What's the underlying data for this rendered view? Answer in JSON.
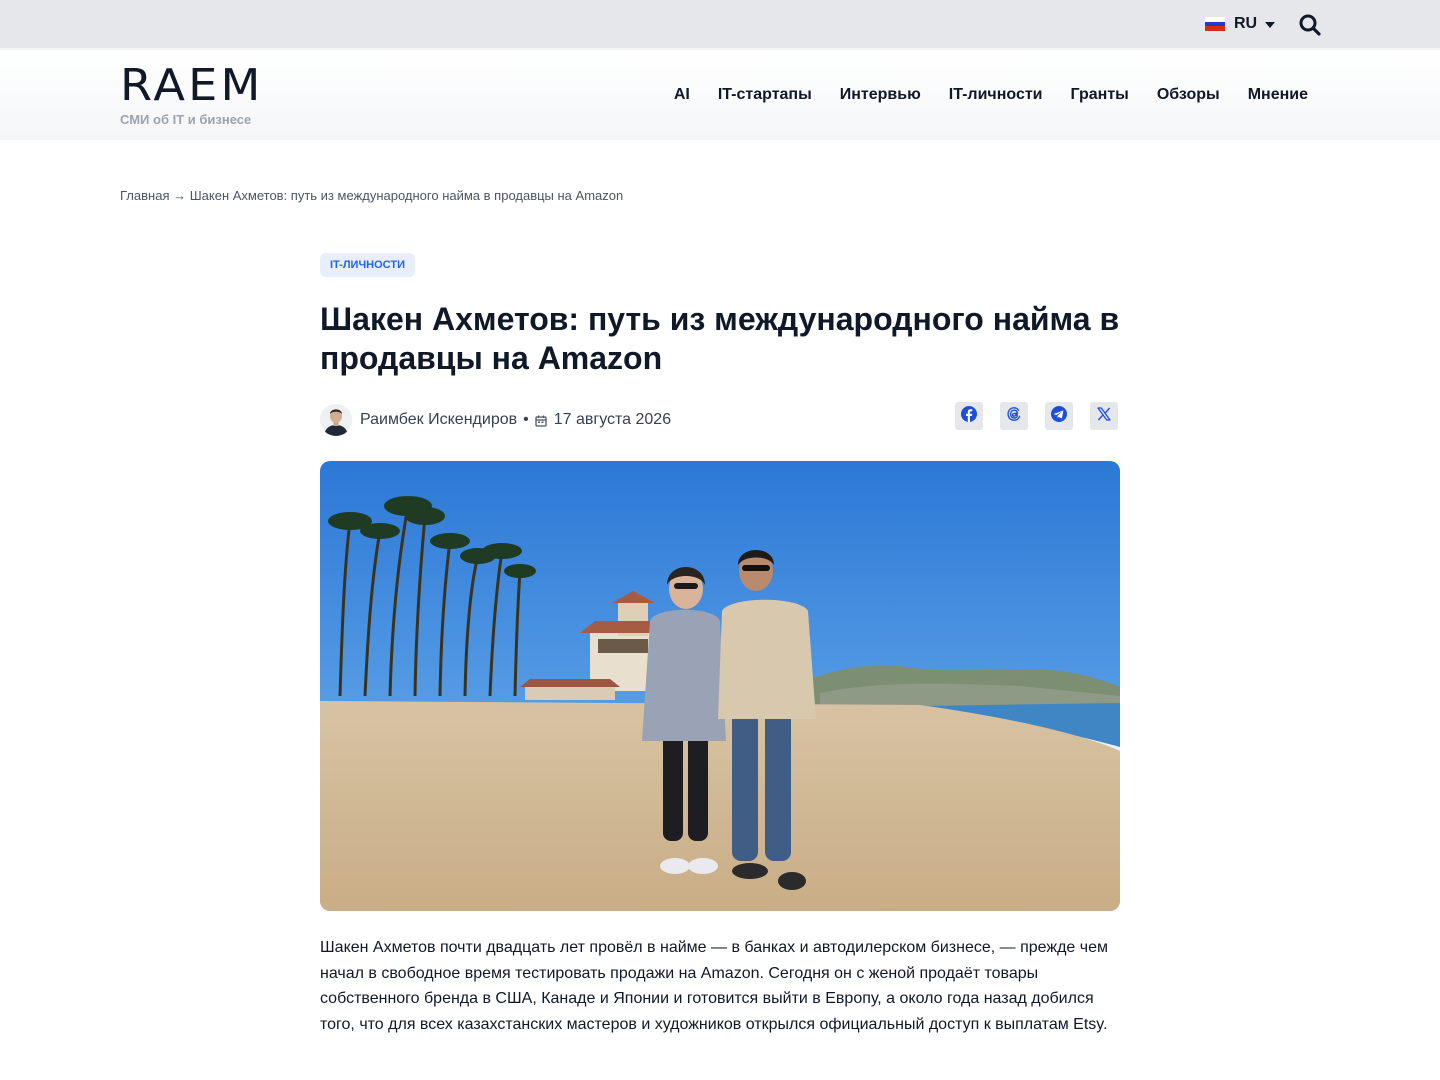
{
  "topbar": {
    "language": "RU",
    "flag_colors": [
      "#ffffff",
      "#1f3fbf",
      "#d52b1e"
    ]
  },
  "header": {
    "logo": "RAEM",
    "tagline": "СМИ об IT и бизнесе",
    "nav": [
      "AI",
      "IT-стартапы",
      "Интервью",
      "IT-личности",
      "Гранты",
      "Обзоры",
      "Мнение"
    ]
  },
  "breadcrumb": {
    "home": "Главная",
    "separator": "→",
    "current": "Шакен Ахметов: путь из международного найма в продавцы на Amazon"
  },
  "article": {
    "category": "IT-ЛИЧНОСТИ",
    "title": "Шакен Ахметов: путь из международного найма в продавцы на Amazon",
    "author": "Раимбек Искендиров",
    "meta_separator": "•",
    "date": "17 августа 2026",
    "share": [
      "facebook-icon",
      "threads-icon",
      "telegram-icon",
      "x-icon"
    ],
    "lead": "Шакен Ахметов почти двадцать лет провёл в найме — в банках и автодилерском бизнесе, — прежде чем начал в свободное время тестировать продажи на Amazon. Сегодня он с женой продаёт товары собственного бренда в США, Канаде и Японии и готовится выйти в Европу, а около года назад добился того, что для всех казахстанских мастеров и художников открылся официальный доступ к выплатам Etsy."
  },
  "colors": {
    "accent": "#2563eb",
    "text": "#111827",
    "muted": "#9ca3af"
  }
}
